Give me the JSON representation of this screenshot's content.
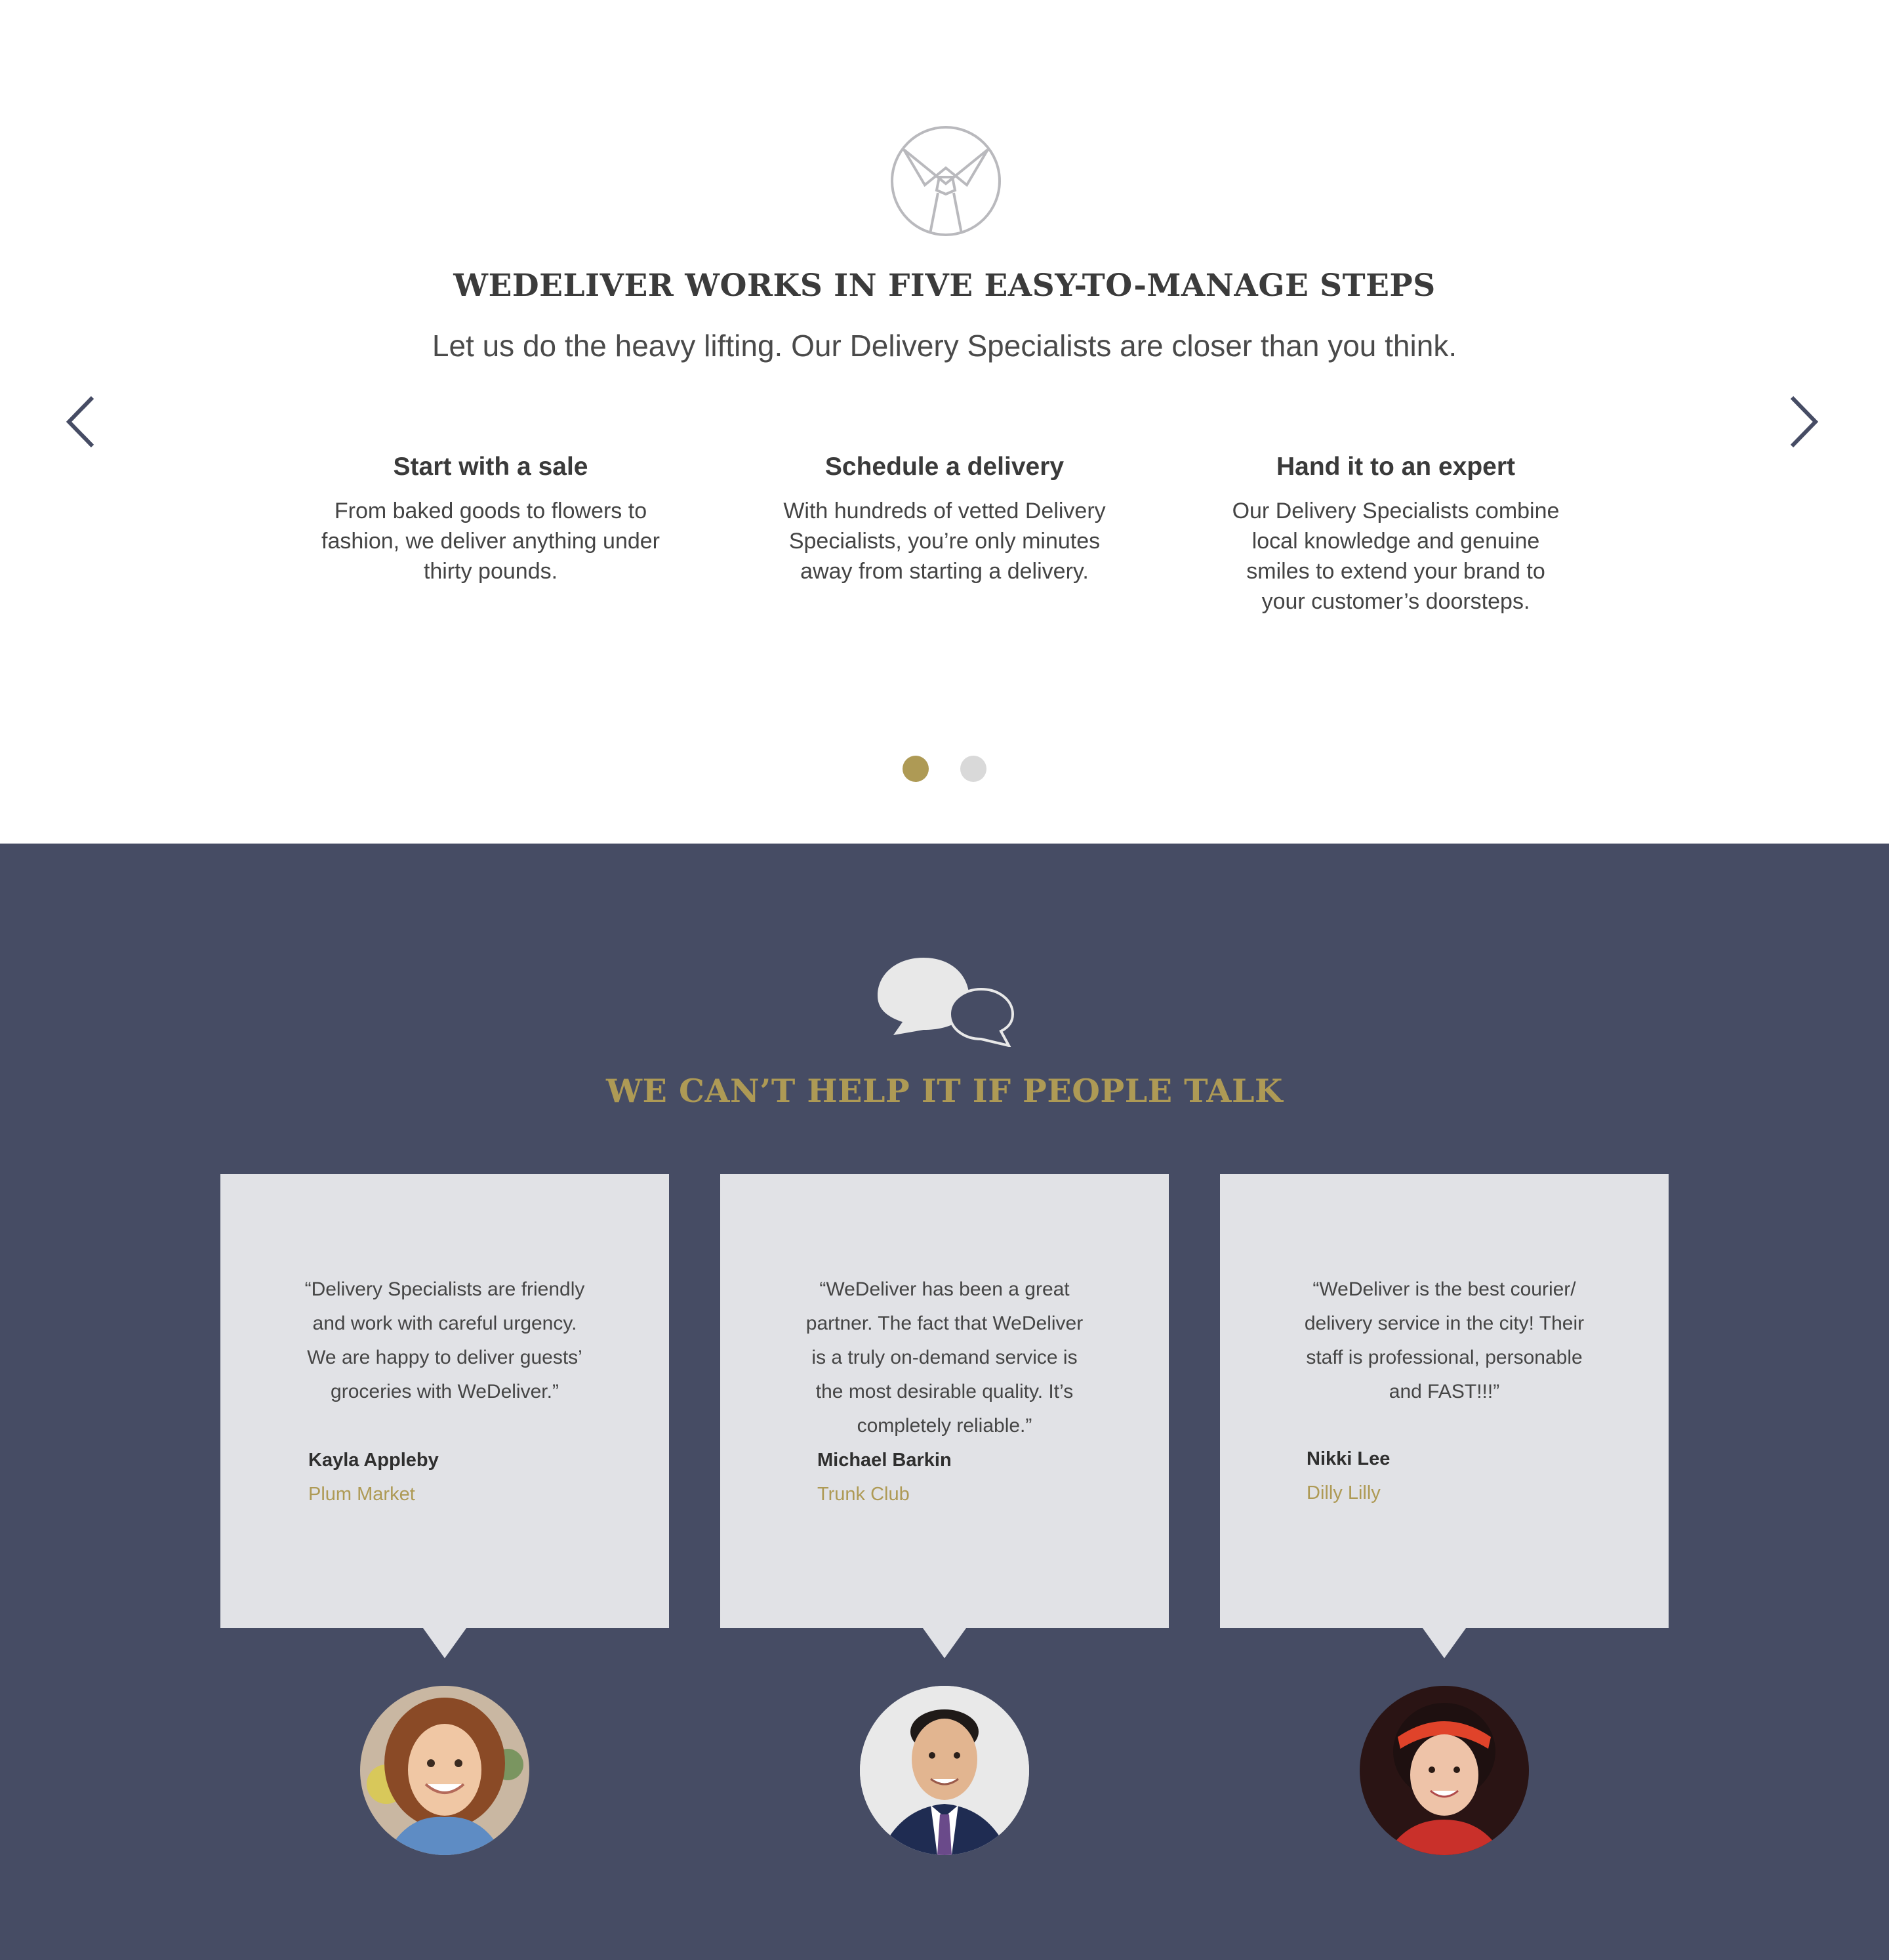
{
  "steps": {
    "logo_icon": "tie-emblem-icon",
    "title": "WEDELIVER WORKS IN FIVE EASY-TO-MANAGE STEPS",
    "subtitle": "Let us do the heavy lifting. Our Delivery Specialists are closer than you think.",
    "prev_icon": "chevron-left-icon",
    "next_icon": "chevron-right-icon",
    "items": [
      {
        "title": "Start with a sale",
        "text": "From baked goods to flowers to fashion, we deliver anything under thirty pounds."
      },
      {
        "title": "Schedule a delivery",
        "text": "With hundreds of vetted Delivery Specialists,  you’re only minutes away from starting a delivery."
      },
      {
        "title": "Hand it to an expert",
        "text": "Our Delivery Specialists combine local knowledge  and genuine smiles to extend your brand to your customer’s doorsteps."
      }
    ],
    "carousel": {
      "current_page": 1,
      "total_pages": 2
    }
  },
  "testimonials": {
    "icon": "speech-bubbles-icon",
    "title": "WE CAN’T HELP IT IF PEOPLE TALK",
    "items": [
      {
        "quote": "“Delivery Specialists are friendly and work with careful urgency. We are happy to deliver guests’ groceries with WeDeliver.”",
        "author": "Kayla Appleby",
        "company": "Plum Market"
      },
      {
        "quote": "“WeDeliver has been a great partner. The fact that WeDeliver is a truly on-demand service is the most desirable quality. It’s completely reliable.”",
        "author": "Michael Barkin",
        "company": "Trunk Club"
      },
      {
        "quote": "“WeDeliver is the best courier/ delivery service in the city! Their staff is professional, personable and FAST!!!”",
        "author": "Nikki Lee",
        "company": "Dilly Lilly"
      }
    ]
  },
  "colors": {
    "accent_gold": "#ae9a55",
    "navy_background": "#464c64",
    "card_background": "#e1e2e6",
    "dot_inactive": "#d9d9d9"
  }
}
